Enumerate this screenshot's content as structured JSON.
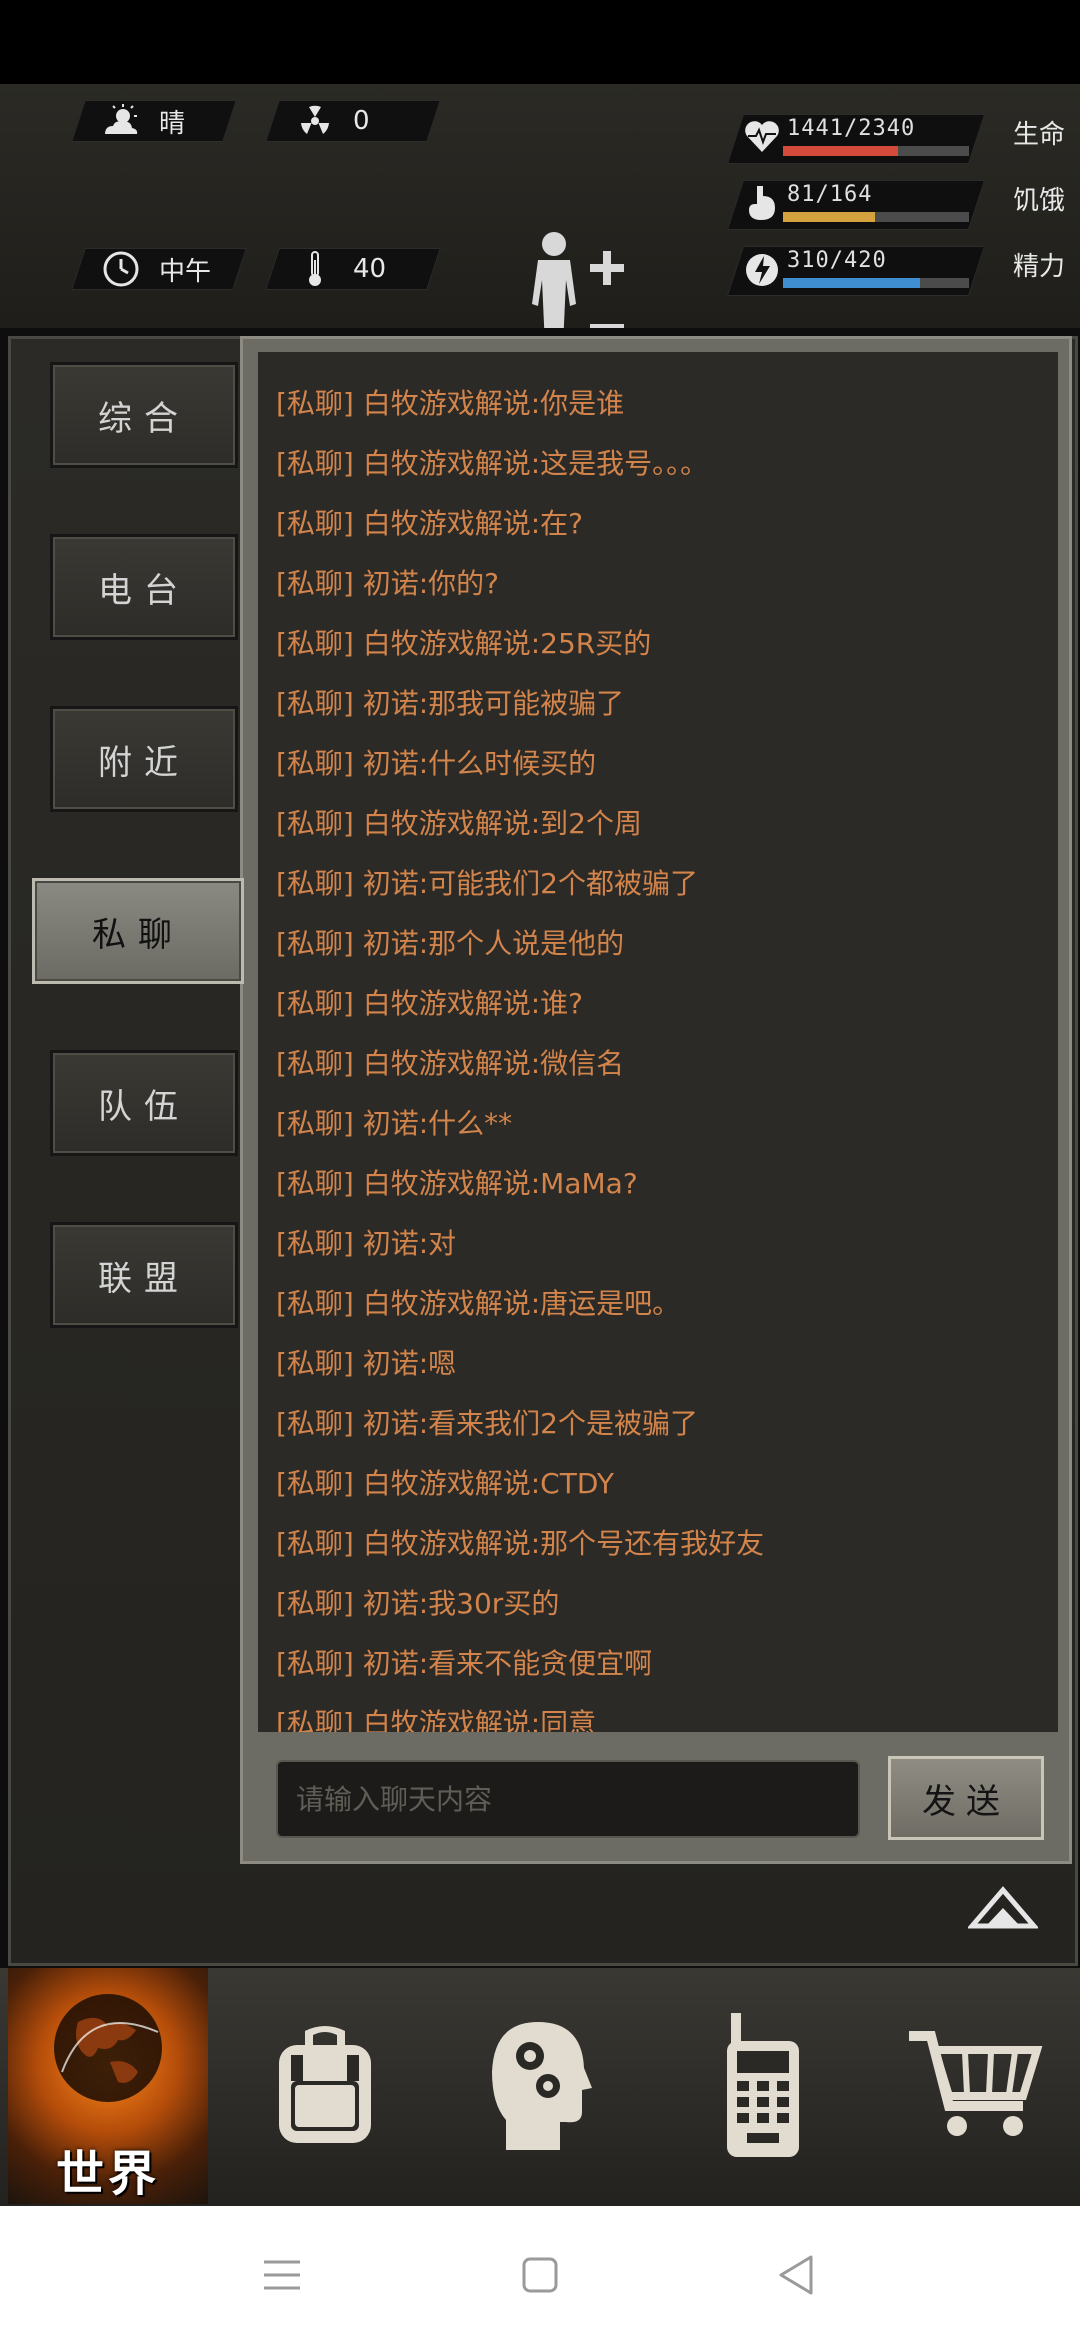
{
  "hud": {
    "weather": "晴",
    "radiation": "0",
    "time_of_day": "中午",
    "temperature": "40",
    "stats": [
      {
        "value": "1441/2340",
        "label": "生命",
        "fraction": 0.616,
        "color": "#d24b3b",
        "icon": "heart-icon"
      },
      {
        "value": "81/164",
        "label": "饥饿",
        "fraction": 0.494,
        "color": "#d4a23f",
        "icon": "stomach-icon"
      },
      {
        "value": "310/420",
        "label": "精力",
        "fraction": 0.738,
        "color": "#3f8fd0",
        "icon": "energy-icon"
      }
    ]
  },
  "tabs": [
    {
      "label": "综合",
      "active": false
    },
    {
      "label": "电台",
      "active": false
    },
    {
      "label": "附近",
      "active": false
    },
    {
      "label": "私聊",
      "active": true
    },
    {
      "label": "队伍",
      "active": false
    },
    {
      "label": "联盟",
      "active": false
    }
  ],
  "messages": [
    "[私聊] 白牧游戏解说:你是谁",
    "[私聊] 白牧游戏解说:这是我号。。。",
    "[私聊] 白牧游戏解说:在?",
    "[私聊] 初诺:你的?",
    "[私聊] 白牧游戏解说:25R买的",
    "[私聊] 初诺:那我可能被骗了",
    "[私聊] 初诺:什么时候买的",
    "[私聊] 白牧游戏解说:到2个周",
    "[私聊] 初诺:可能我们2个都被骗了",
    "[私聊] 初诺:那个人说是他的",
    "[私聊] 白牧游戏解说:谁?",
    "[私聊] 白牧游戏解说:微信名",
    "[私聊] 初诺:什么**",
    "[私聊] 白牧游戏解说:MaMa?",
    "[私聊] 初诺:对",
    "[私聊] 白牧游戏解说:唐运是吧。",
    "[私聊] 初诺:嗯",
    "[私聊] 初诺:看来我们2个是被骗了",
    "[私聊] 白牧游戏解说:CTDY",
    "[私聊] 白牧游戏解说:那个号还有我好友",
    "[私聊] 初诺:我30r买的",
    "[私聊] 初诺:看来不能贪便宜啊",
    "[私聊] 白牧游戏解说:同意"
  ],
  "input": {
    "placeholder": "请输入聊天内容",
    "value": ""
  },
  "send_label": "发送",
  "bottom_nav": {
    "world_label": "世界",
    "items": [
      "backpack-icon",
      "skills-head-icon",
      "radio-icon",
      "cart-icon"
    ]
  }
}
